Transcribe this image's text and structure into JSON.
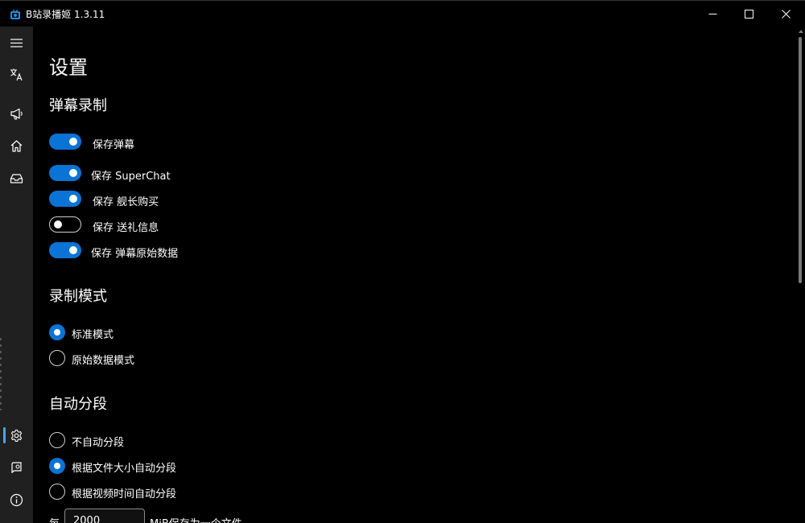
{
  "window": {
    "title": "B站录播姬 1.3.11",
    "minimize_icon": "minimize-icon",
    "maximize_icon": "maximize-icon",
    "close_icon": "close-icon"
  },
  "nav": {
    "items": [
      {
        "icon": "hamburger-menu-icon"
      },
      {
        "icon": "translate-icon"
      },
      {
        "icon": "megaphone-icon"
      },
      {
        "icon": "home-icon"
      },
      {
        "icon": "inbox-icon"
      },
      {
        "icon": "gear-icon",
        "selected": true
      },
      {
        "icon": "log-icon"
      },
      {
        "icon": "info-icon"
      }
    ],
    "accent": "#4aa3ff"
  },
  "settings": {
    "title": "设置",
    "danmaku": {
      "title": "弹幕录制",
      "toggles": [
        {
          "label": "保存弹幕",
          "on": true
        },
        {
          "label": "保存 SuperChat",
          "on": true
        },
        {
          "label": "保存 舰长购买",
          "on": true
        },
        {
          "label": "保存 送礼信息",
          "on": false
        },
        {
          "label": "保存 弹幕原始数据",
          "on": true
        }
      ]
    },
    "record_mode": {
      "title": "录制模式",
      "options": [
        {
          "label": "标准模式",
          "selected": true
        },
        {
          "label": "原始数据模式",
          "selected": false
        }
      ]
    },
    "auto_split": {
      "title": "自动分段",
      "options": [
        {
          "label": "不自动分段",
          "selected": false
        },
        {
          "label": "根据文件大小自动分段",
          "selected": true
        },
        {
          "label": "根据视频时间自动分段",
          "selected": false
        }
      ],
      "per_label": "每",
      "size_value": "2000",
      "suffix": "MiB保存为一个文件"
    }
  },
  "colors": {
    "accent": "#0a74d6",
    "background": "#000000",
    "nav_background": "#202020"
  }
}
